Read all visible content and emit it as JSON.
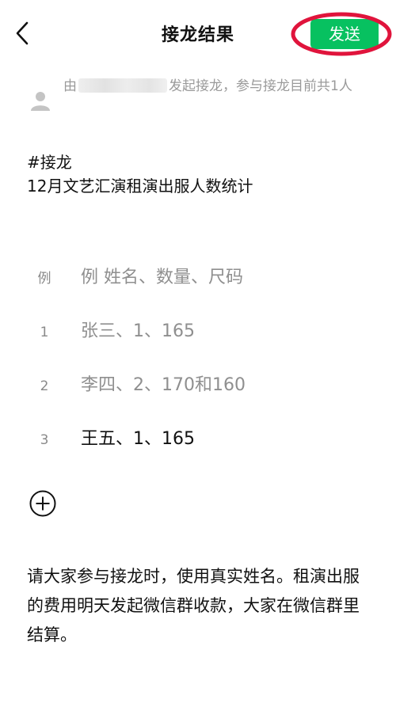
{
  "header": {
    "title": "接龙结果",
    "send_label": "发送"
  },
  "initiator": {
    "prefix": "由",
    "suffix": "发起接龙，参与接龙目前共1人"
  },
  "topic": {
    "tag": "#接龙",
    "description": "12月文艺汇演租演出服人数统计"
  },
  "entries": [
    {
      "index": "例",
      "text": "例 姓名、数量、尺码"
    },
    {
      "index": "1",
      "text": "张三、1、165"
    },
    {
      "index": "2",
      "text": "李四、2、170和160"
    },
    {
      "index": "3",
      "text": "王五、1、165"
    }
  ],
  "note": "请大家参与接龙时，使用真实姓名。租演出服的费用明天发起微信群收款，大家在微信群里结算。",
  "icons": {
    "back": "chevron-left-icon",
    "avatar": "user-icon",
    "add": "plus-circle-icon"
  },
  "colors": {
    "accent_green": "#07c160",
    "annotation_red": "#e0143c",
    "muted_text": "#8f8f8f"
  }
}
